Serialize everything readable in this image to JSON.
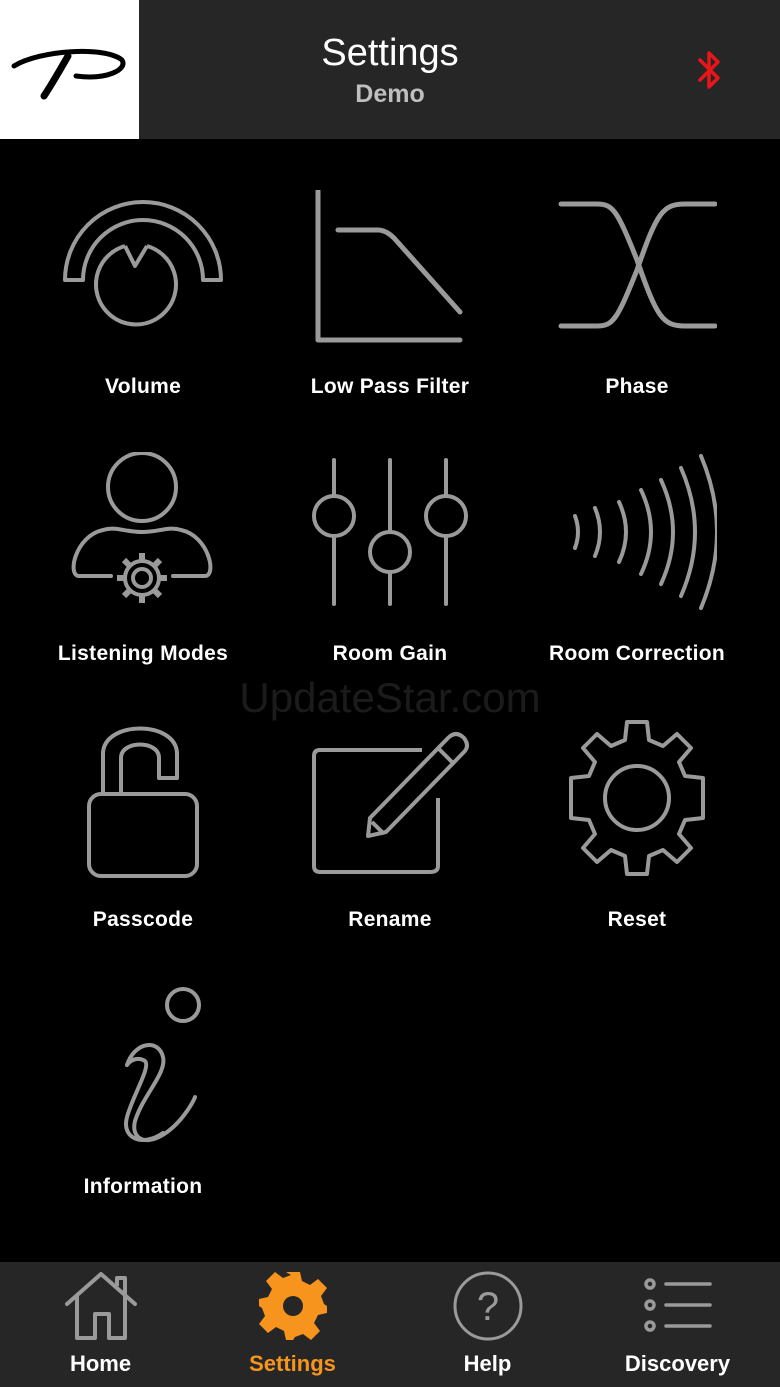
{
  "header": {
    "title": "Settings",
    "subtitle": "Demo",
    "logo_icon": "brand-p-logo",
    "bluetooth_icon": "bluetooth-icon",
    "bluetooth_color": "#e8161b"
  },
  "tiles": [
    {
      "label": "Volume",
      "icon": "volume-knob-icon"
    },
    {
      "label": "Low Pass Filter",
      "icon": "low-pass-filter-icon"
    },
    {
      "label": "Phase",
      "icon": "phase-icon"
    },
    {
      "label": "Listening Modes",
      "icon": "user-gear-icon"
    },
    {
      "label": "Room Gain",
      "icon": "sliders-icon"
    },
    {
      "label": "Room Correction",
      "icon": "sound-waves-icon"
    },
    {
      "label": "Passcode",
      "icon": "unlocked-padlock-icon"
    },
    {
      "label": "Rename",
      "icon": "edit-pencil-icon"
    },
    {
      "label": "Reset",
      "icon": "gear-icon"
    },
    {
      "label": "Information",
      "icon": "information-icon"
    }
  ],
  "watermark": "UpdateStar.com",
  "tabbar": {
    "active_color": "#f7941d",
    "items": [
      {
        "label": "Home",
        "icon": "home-icon"
      },
      {
        "label": "Settings",
        "icon": "gear-icon",
        "active": true
      },
      {
        "label": "Help",
        "icon": "help-icon"
      },
      {
        "label": "Discovery",
        "icon": "list-icon"
      }
    ]
  }
}
